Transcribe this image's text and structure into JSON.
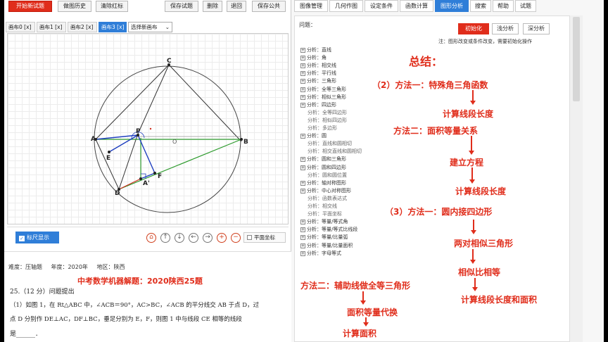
{
  "toolbar": {
    "buttons": [
      "开始新试题",
      "做图历史",
      "清除红标",
      "保存试题",
      "删除",
      "退回",
      "保存公共"
    ]
  },
  "canvas_tabs": {
    "tabs": [
      "画布0 [x]",
      "画布1 [x]",
      "画布2 [x]",
      "画布3 [x]"
    ],
    "active_index": 3,
    "select_value": "选择新画布"
  },
  "geometry": {
    "points": {
      "C": "C",
      "A": "A",
      "B": "B",
      "P": "P",
      "O": "O",
      "E": "E",
      "F": "F",
      "D": "D",
      "A1": "A'"
    }
  },
  "controls": {
    "ruler_label": "标尺显示",
    "ruler_checked": "✓",
    "zoom_buttons": [
      "⌂",
      "↑",
      "↓",
      "←",
      "→",
      "+",
      "−"
    ],
    "coord_label": "平面坐标"
  },
  "info": {
    "difficulty": "难度：压轴题",
    "year": "年度：2020年",
    "region": "地区：陕西",
    "banner": "中考数学机器解题：2020陕西25题",
    "q_line1": "25.（12 分）问题提出",
    "q_line2": "（1）如图 1，在 Rt△ABC 中，∠ACB＝90°，AC>BC，∠ACB 的平分线交 AB 于点 D，过",
    "q_line3": "点 D 分别作 DE⊥AC，DF⊥BC，垂足分别为 E，F，则图 1 中与线段 CE 相等的线段",
    "q_line4": "是______．"
  },
  "right_tabs": {
    "tabs": [
      "图像管理",
      "几何作图",
      "设定条件",
      "函数计算",
      "图形分析",
      "搜索",
      "帮助",
      "试题"
    ],
    "active_index": 4
  },
  "analysis": {
    "question_label": "问题：",
    "buttons": [
      "初始化",
      "浅分析",
      "深分析"
    ],
    "note": "注：图形改变或条件改变，需要初始化操作",
    "tree": [
      {
        "label": "分析：直线",
        "leaf": false
      },
      {
        "label": "分析：角",
        "leaf": false
      },
      {
        "label": "分析：相交线",
        "leaf": false
      },
      {
        "label": "分析：平行线",
        "leaf": false
      },
      {
        "label": "分析：三角形",
        "leaf": false
      },
      {
        "label": "分析：全等三角形",
        "leaf": false
      },
      {
        "label": "分析：相似三角形",
        "leaf": false
      },
      {
        "label": "分析：四边形",
        "leaf": false
      },
      {
        "label": "分析：全等四边形",
        "leaf": true
      },
      {
        "label": "分析：相似四边形",
        "leaf": true
      },
      {
        "label": "分析：多边形",
        "leaf": true
      },
      {
        "label": "分析：圆",
        "leaf": false
      },
      {
        "label": "分析：直线和圆相切",
        "leaf": true
      },
      {
        "label": "分析：相交直线和圆相切",
        "leaf": true
      },
      {
        "label": "分析：圆和三角形",
        "leaf": false
      },
      {
        "label": "分析：圆和四边形",
        "leaf": false
      },
      {
        "label": "分析：圆和圆位置",
        "leaf": true
      },
      {
        "label": "分析：轴对称图形",
        "leaf": false
      },
      {
        "label": "分析：中心对称图形",
        "leaf": false
      },
      {
        "label": "分析：函数表达式",
        "leaf": true
      },
      {
        "label": "分析：相交线",
        "leaf": true
      },
      {
        "label": "分析：平面坐标",
        "leaf": true
      },
      {
        "label": "分析：等量/等式角",
        "leaf": false
      },
      {
        "label": "分析：等量/等式比线段",
        "leaf": false
      },
      {
        "label": "分析：等量/比量弧",
        "leaf": false
      },
      {
        "label": "分析：等量/比量面积",
        "leaf": false
      },
      {
        "label": "分析：字母等式",
        "leaf": false
      }
    ]
  },
  "summary": {
    "title": "总结：",
    "s2_method1": "（2）方法一：特殊角三角函数",
    "s2_calc1": "计算线段长度",
    "s2_method2": "方法二：面积等量关系",
    "s2_build": "建立方程",
    "s2_calc2": "计算线段长度",
    "s3_method1": "（3）方法一：圆内接四边形",
    "s3_similar": "两对相似三角形",
    "s3_ratio": "相似比相等",
    "s3_calc": "计算线段长度和面积",
    "s3_method2": "方法二：辅助线做全等三角形",
    "s3_area_sub": "面积等量代换",
    "s3_area_calc": "计算面积"
  },
  "colors": {
    "accent_red": "#e02d1b",
    "accent_blue": "#2f7ed8",
    "line_green": "#2e9b2e",
    "line_blue": "#1f3fbf",
    "line_red": "#d03020"
  }
}
